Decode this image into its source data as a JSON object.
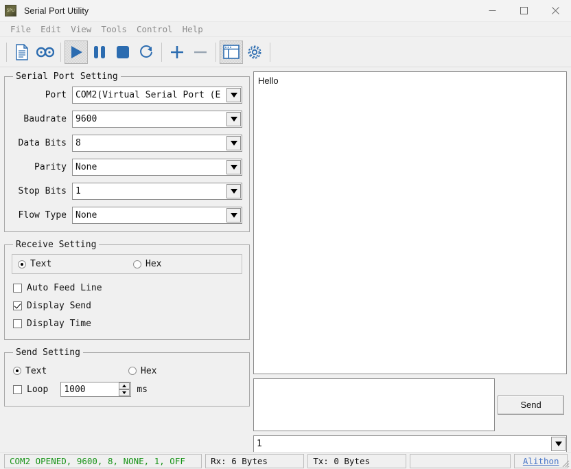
{
  "window": {
    "title": "Serial Port Utility",
    "app_icon": "spu-app-icon",
    "controls": {
      "minimize": "minimize-icon",
      "maximize": "maximize-icon",
      "close": "close-icon"
    }
  },
  "menubar": {
    "items": [
      {
        "label": "File"
      },
      {
        "label": "Edit"
      },
      {
        "label": "View"
      },
      {
        "label": "Tools"
      },
      {
        "label": "Control"
      },
      {
        "label": "Help"
      }
    ]
  },
  "toolbar": {
    "buttons": [
      {
        "name": "new-document-icon",
        "pressed": false
      },
      {
        "name": "record-tape-icon",
        "pressed": false
      },
      {
        "name": "play-icon",
        "pressed": true
      },
      {
        "name": "pause-icon",
        "pressed": false
      },
      {
        "name": "stop-icon",
        "pressed": false
      },
      {
        "name": "refresh-icon",
        "pressed": false
      },
      {
        "name": "plus-icon",
        "pressed": false
      },
      {
        "name": "minus-icon",
        "pressed": false
      },
      {
        "name": "layout-window-icon",
        "pressed": true
      },
      {
        "name": "gear-icon",
        "pressed": false
      }
    ]
  },
  "serial_port_setting": {
    "legend": "Serial Port Setting",
    "fields": [
      {
        "label": "Port",
        "value": "COM2(Virtual Serial Port (E"
      },
      {
        "label": "Baudrate",
        "value": "9600"
      },
      {
        "label": "Data Bits",
        "value": "8"
      },
      {
        "label": "Parity",
        "value": "None"
      },
      {
        "label": "Stop Bits",
        "value": "1"
      },
      {
        "label": "Flow Type",
        "value": "None"
      }
    ]
  },
  "receive_setting": {
    "legend": "Receive Setting",
    "format_text": "Text",
    "format_hex": "Hex",
    "format_selected": "Text",
    "checkboxes": [
      {
        "label": "Auto Feed Line",
        "checked": false
      },
      {
        "label": "Display Send",
        "checked": true
      },
      {
        "label": "Display Time",
        "checked": false
      }
    ]
  },
  "send_setting": {
    "legend": "Send Setting",
    "format_text": "Text",
    "format_hex": "Hex",
    "format_selected": "Text",
    "loop_label": "Loop",
    "loop_checked": false,
    "interval_value": "1000",
    "interval_unit": "ms"
  },
  "receive_area": {
    "content": "Hello"
  },
  "send_area": {
    "input_value": "",
    "send_label": "Send",
    "history_value": "1"
  },
  "statusbar": {
    "connection": "COM2 OPENED, 9600, 8, NONE, 1, OFF",
    "rx": "Rx: 6 Bytes",
    "tx": "Tx: 0 Bytes",
    "blank": "",
    "link": "Alithon"
  },
  "colors": {
    "accent": "#2c6cb0",
    "status_green": "#179317",
    "link_blue": "#4a77c8",
    "window_bg": "#f0f0f0"
  }
}
